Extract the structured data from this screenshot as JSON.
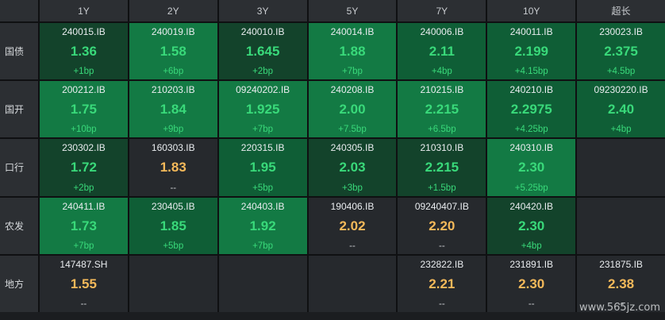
{
  "tenors": [
    "1Y",
    "2Y",
    "3Y",
    "5Y",
    "7Y",
    "10Y",
    "超长"
  ],
  "colors": {
    "deep": "#13432b",
    "mid": "#0f5e36",
    "bright": "#137a44",
    "empty": "#26292d",
    "up_text": "#39d97a",
    "flat_text": "#f4b95a"
  },
  "rows": [
    {
      "label": "国债",
      "cells": [
        {
          "code": "240015.IB",
          "yield": "1.36",
          "change": "+1bp",
          "trend": "up",
          "shade": "deep"
        },
        {
          "code": "240019.IB",
          "yield": "1.58",
          "change": "+6bp",
          "trend": "up",
          "shade": "bright"
        },
        {
          "code": "240010.IB",
          "yield": "1.645",
          "change": "+2bp",
          "trend": "up",
          "shade": "deep"
        },
        {
          "code": "240014.IB",
          "yield": "1.88",
          "change": "+7bp",
          "trend": "up",
          "shade": "bright"
        },
        {
          "code": "240006.IB",
          "yield": "2.11",
          "change": "+4bp",
          "trend": "up",
          "shade": "mid"
        },
        {
          "code": "240011.IB",
          "yield": "2.199",
          "change": "+4.15bp",
          "trend": "up",
          "shade": "mid"
        },
        {
          "code": "230023.IB",
          "yield": "2.375",
          "change": "+4.5bp",
          "trend": "up",
          "shade": "mid"
        }
      ]
    },
    {
      "label": "国开",
      "cells": [
        {
          "code": "200212.IB",
          "yield": "1.75",
          "change": "+10bp",
          "trend": "up",
          "shade": "bright"
        },
        {
          "code": "210203.IB",
          "yield": "1.84",
          "change": "+9bp",
          "trend": "up",
          "shade": "bright"
        },
        {
          "code": "09240202.IB",
          "yield": "1.925",
          "change": "+7bp",
          "trend": "up",
          "shade": "bright"
        },
        {
          "code": "240208.IB",
          "yield": "2.00",
          "change": "+7.5bp",
          "trend": "up",
          "shade": "bright"
        },
        {
          "code": "210215.IB",
          "yield": "2.215",
          "change": "+6.5bp",
          "trend": "up",
          "shade": "bright"
        },
        {
          "code": "240210.IB",
          "yield": "2.2975",
          "change": "+4.25bp",
          "trend": "up",
          "shade": "mid"
        },
        {
          "code": "09230220.IB",
          "yield": "2.40",
          "change": "+4bp",
          "trend": "up",
          "shade": "mid"
        }
      ]
    },
    {
      "label": "口行",
      "cells": [
        {
          "code": "230302.IB",
          "yield": "1.72",
          "change": "+2bp",
          "trend": "up",
          "shade": "deep"
        },
        {
          "code": "160303.IB",
          "yield": "1.83",
          "change": "--",
          "trend": "flat",
          "shade": "empty"
        },
        {
          "code": "220315.IB",
          "yield": "1.95",
          "change": "+5bp",
          "trend": "up",
          "shade": "mid"
        },
        {
          "code": "240305.IB",
          "yield": "2.03",
          "change": "+3bp",
          "trend": "up",
          "shade": "deep"
        },
        {
          "code": "210310.IB",
          "yield": "2.215",
          "change": "+1.5bp",
          "trend": "up",
          "shade": "deep"
        },
        {
          "code": "240310.IB",
          "yield": "2.30",
          "change": "+5.25bp",
          "trend": "up",
          "shade": "bright"
        },
        {
          "code": "",
          "yield": "",
          "change": "",
          "trend": "none",
          "shade": "empty"
        }
      ]
    },
    {
      "label": "农发",
      "cells": [
        {
          "code": "240411.IB",
          "yield": "1.73",
          "change": "+7bp",
          "trend": "up",
          "shade": "bright"
        },
        {
          "code": "230405.IB",
          "yield": "1.85",
          "change": "+5bp",
          "trend": "up",
          "shade": "mid"
        },
        {
          "code": "240403.IB",
          "yield": "1.92",
          "change": "+7bp",
          "trend": "up",
          "shade": "bright"
        },
        {
          "code": "190406.IB",
          "yield": "2.02",
          "change": "--",
          "trend": "flat",
          "shade": "empty"
        },
        {
          "code": "09240407.IB",
          "yield": "2.20",
          "change": "--",
          "trend": "flat",
          "shade": "empty"
        },
        {
          "code": "240420.IB",
          "yield": "2.30",
          "change": "+4bp",
          "trend": "up",
          "shade": "deep"
        },
        {
          "code": "",
          "yield": "",
          "change": "",
          "trend": "none",
          "shade": "empty"
        }
      ]
    },
    {
      "label": "地方",
      "cells": [
        {
          "code": "147487.SH",
          "yield": "1.55",
          "change": "--",
          "trend": "flat",
          "shade": "empty"
        },
        {
          "code": "",
          "yield": "",
          "change": "",
          "trend": "none",
          "shade": "empty"
        },
        {
          "code": "",
          "yield": "",
          "change": "",
          "trend": "none",
          "shade": "empty"
        },
        {
          "code": "",
          "yield": "",
          "change": "",
          "trend": "none",
          "shade": "empty"
        },
        {
          "code": "232822.IB",
          "yield": "2.21",
          "change": "--",
          "trend": "flat",
          "shade": "empty"
        },
        {
          "code": "231891.IB",
          "yield": "2.30",
          "change": "--",
          "trend": "flat",
          "shade": "empty"
        },
        {
          "code": "231875.IB",
          "yield": "2.38",
          "change": "--",
          "trend": "flat",
          "shade": "empty"
        }
      ]
    }
  ],
  "watermark": "www.565jz.com"
}
